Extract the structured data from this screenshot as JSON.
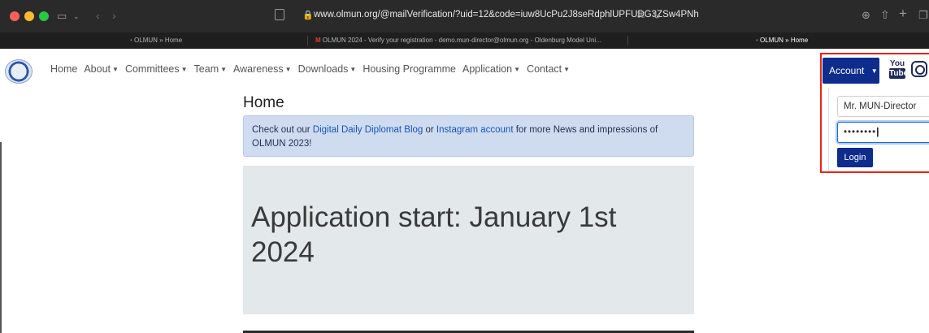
{
  "browser": {
    "url": "www.olmun.org/@mailVerification/?uid=12&code=iuw8UcPu2J8seRdphlUPFUDG3ZSw4PNh",
    "tabs": [
      {
        "label": "OLMUN » Home",
        "active": false
      },
      {
        "label": "OLMUN 2024 - Verify your registration - demo.mun-director@olmun.org - Oldenburg Model Uni...",
        "active": false
      },
      {
        "label": "OLMUN » Home",
        "active": true
      }
    ]
  },
  "nav": {
    "items": [
      {
        "label": "Home",
        "dropdown": false
      },
      {
        "label": "About",
        "dropdown": true
      },
      {
        "label": "Committees",
        "dropdown": true
      },
      {
        "label": "Team",
        "dropdown": true
      },
      {
        "label": "Awareness",
        "dropdown": true
      },
      {
        "label": "Downloads",
        "dropdown": true
      },
      {
        "label": "Housing Programme",
        "dropdown": false
      },
      {
        "label": "Application",
        "dropdown": true
      },
      {
        "label": "Contact",
        "dropdown": true
      }
    ],
    "caret": "▼"
  },
  "account": {
    "button_label": "Account",
    "youtube_label_1": "You",
    "youtube_label_2": "Tube",
    "username_value": "Mr. MUN-Director",
    "password_value": "••••••••",
    "login_label": "Login"
  },
  "main": {
    "heading": "Home",
    "alert_prefix": "Check out our ",
    "alert_link1": "Digital Daily Diplomat Blog",
    "alert_mid": " or ",
    "alert_link2": "Instagram account",
    "alert_suffix": " for more News and impressions of OLMUN 2023!",
    "jumbotron_title": "Application start: January 1st 2024"
  },
  "colors": {
    "accent": "#0d2c8c",
    "highlight": "#e8231c",
    "alert_bg": "#cfdcf0"
  }
}
